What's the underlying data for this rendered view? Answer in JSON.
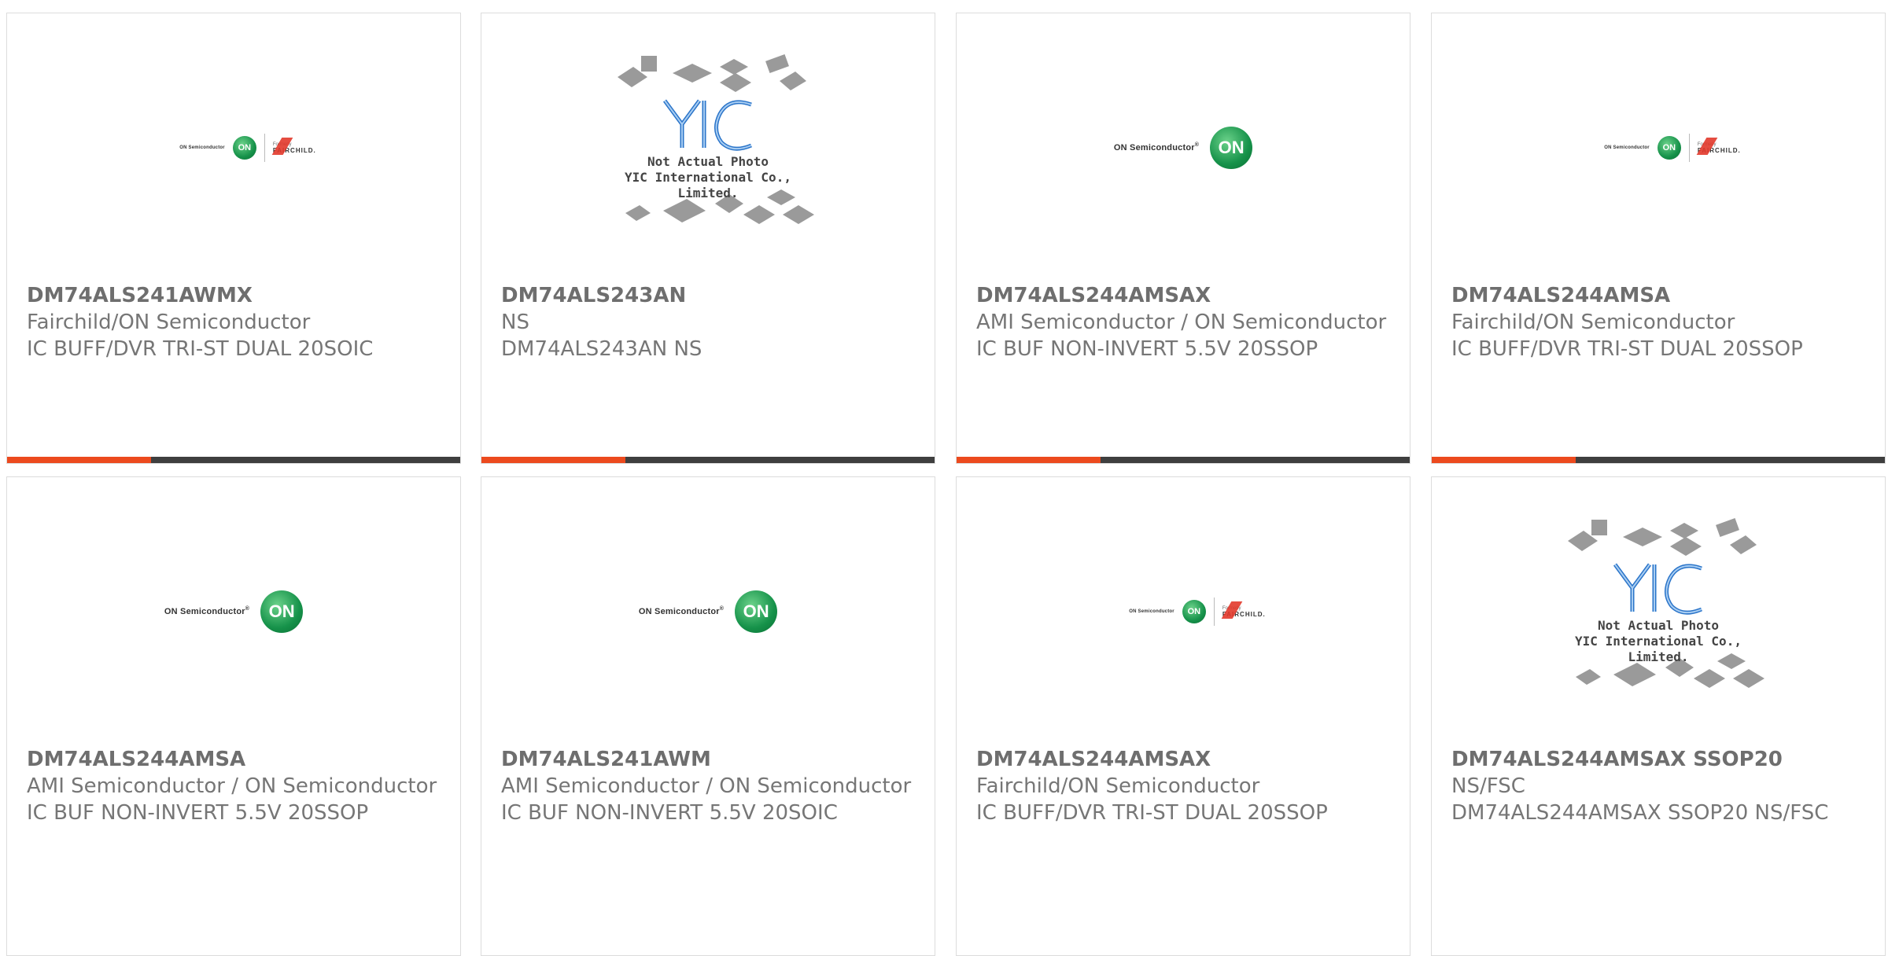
{
  "colors": {
    "accent": "#ec4a1e",
    "bar_dark": "#3f3f3f",
    "on_green": "#16924a",
    "fairchild_red": "#e2382b",
    "yic_blue": "#2a74c9"
  },
  "logos": {
    "on_semi": {
      "text": "ON Semiconductor",
      "mark": "ON",
      "reg": "®"
    },
    "on_fairchild": {
      "on_text": "ON Semiconductor",
      "mark": "ON",
      "formerly": "Formerly",
      "fairchild": "FAIRCHILD."
    },
    "yic": {
      "line1": "Not Actual Photo",
      "line2": "YIC International Co., Limited."
    }
  },
  "products": [
    {
      "part": "DM74ALS241AWMX",
      "maker": "Fairchild/ON Semiconductor",
      "desc": "IC BUFF/DVR TRI-ST DUAL 20SOIC",
      "logo": "on-fairchild-logo"
    },
    {
      "part": "DM74ALS243AN",
      "maker": "NS",
      "desc": "DM74ALS243AN NS",
      "logo": "yic-placeholder-logo"
    },
    {
      "part": "DM74ALS244AMSAX",
      "maker": "AMI Semiconductor / ON Semiconductor",
      "desc": "IC BUF NON-INVERT 5.5V 20SSOP",
      "logo": "on-semi-logo"
    },
    {
      "part": "DM74ALS244AMSA",
      "maker": "Fairchild/ON Semiconductor",
      "desc": "IC BUFF/DVR TRI-ST DUAL 20SSOP",
      "logo": "on-fairchild-logo"
    },
    {
      "part": "DM74ALS244AMSA",
      "maker": "AMI Semiconductor / ON Semiconductor",
      "desc": "IC BUF NON-INVERT 5.5V 20SSOP",
      "logo": "on-semi-logo"
    },
    {
      "part": "DM74ALS241AWM",
      "maker": "AMI Semiconductor / ON Semiconductor",
      "desc": "IC BUF NON-INVERT 5.5V 20SOIC",
      "logo": "on-semi-logo"
    },
    {
      "part": "DM74ALS244AMSAX",
      "maker": "Fairchild/ON Semiconductor",
      "desc": "IC BUFF/DVR TRI-ST DUAL 20SSOP",
      "logo": "on-fairchild-logo"
    },
    {
      "part": "DM74ALS244AMSAX SSOP20",
      "maker": "NS/FSC",
      "desc": "DM74ALS244AMSAX SSOP20 NS/FSC",
      "logo": "yic-placeholder-logo"
    }
  ]
}
